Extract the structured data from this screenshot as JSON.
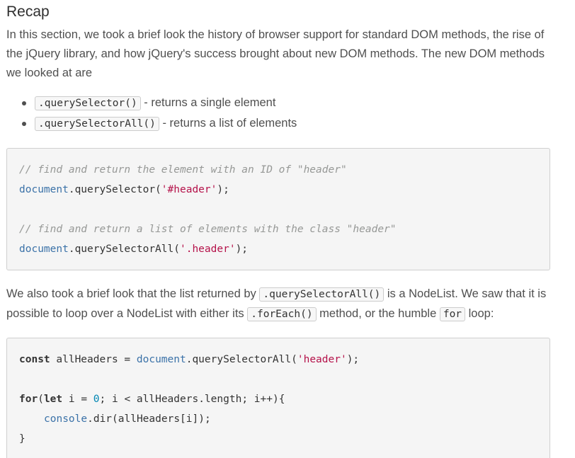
{
  "heading": "Recap",
  "intro": "In this section, we took a brief look the history of browser support for standard DOM methods, the rise of the jQuery library, and how jQuery's success brought about new DOM methods. The new DOM methods we looked at are",
  "bullets": [
    {
      "code": ".querySelector()",
      "text": " - returns a single element"
    },
    {
      "code": ".querySelectorAll()",
      "text": " - returns a list of elements"
    }
  ],
  "code_block_1": {
    "comment1": "// find and return the element with an ID of \"header\"",
    "line1_obj": "document",
    "line1_method": ".querySelector(",
    "line1_str": "'#header'",
    "line1_end": ");",
    "comment2": "// find and return a list of elements with the class \"header\"",
    "line2_obj": "document",
    "line2_method": ".querySelectorAll(",
    "line2_str": "'.header'",
    "line2_end": ");"
  },
  "para2": {
    "part1": "We also took a brief look that the list returned by ",
    "code1": ".querySelectorAll()",
    "part2": " is a NodeList. We saw that it is possible to loop over a NodeList with either its ",
    "code2": ".forEach()",
    "part3": " method, or the humble ",
    "code3": "for",
    "part4": " loop:"
  },
  "code_block_2": {
    "l1_kw": "const",
    "l1_mid": " allHeaders = ",
    "l1_obj": "document",
    "l1_method": ".querySelectorAll(",
    "l1_str": "'header'",
    "l1_end": ");",
    "l2_kw1": "for",
    "l2_p1": "(",
    "l2_kw2": "let",
    "l2_mid": " i = ",
    "l2_num": "0",
    "l2_rest": "; i < allHeaders.length; i++){",
    "l3_obj": "console",
    "l3_rest": ".dir(allHeaders[i]);",
    "l4": "}"
  }
}
